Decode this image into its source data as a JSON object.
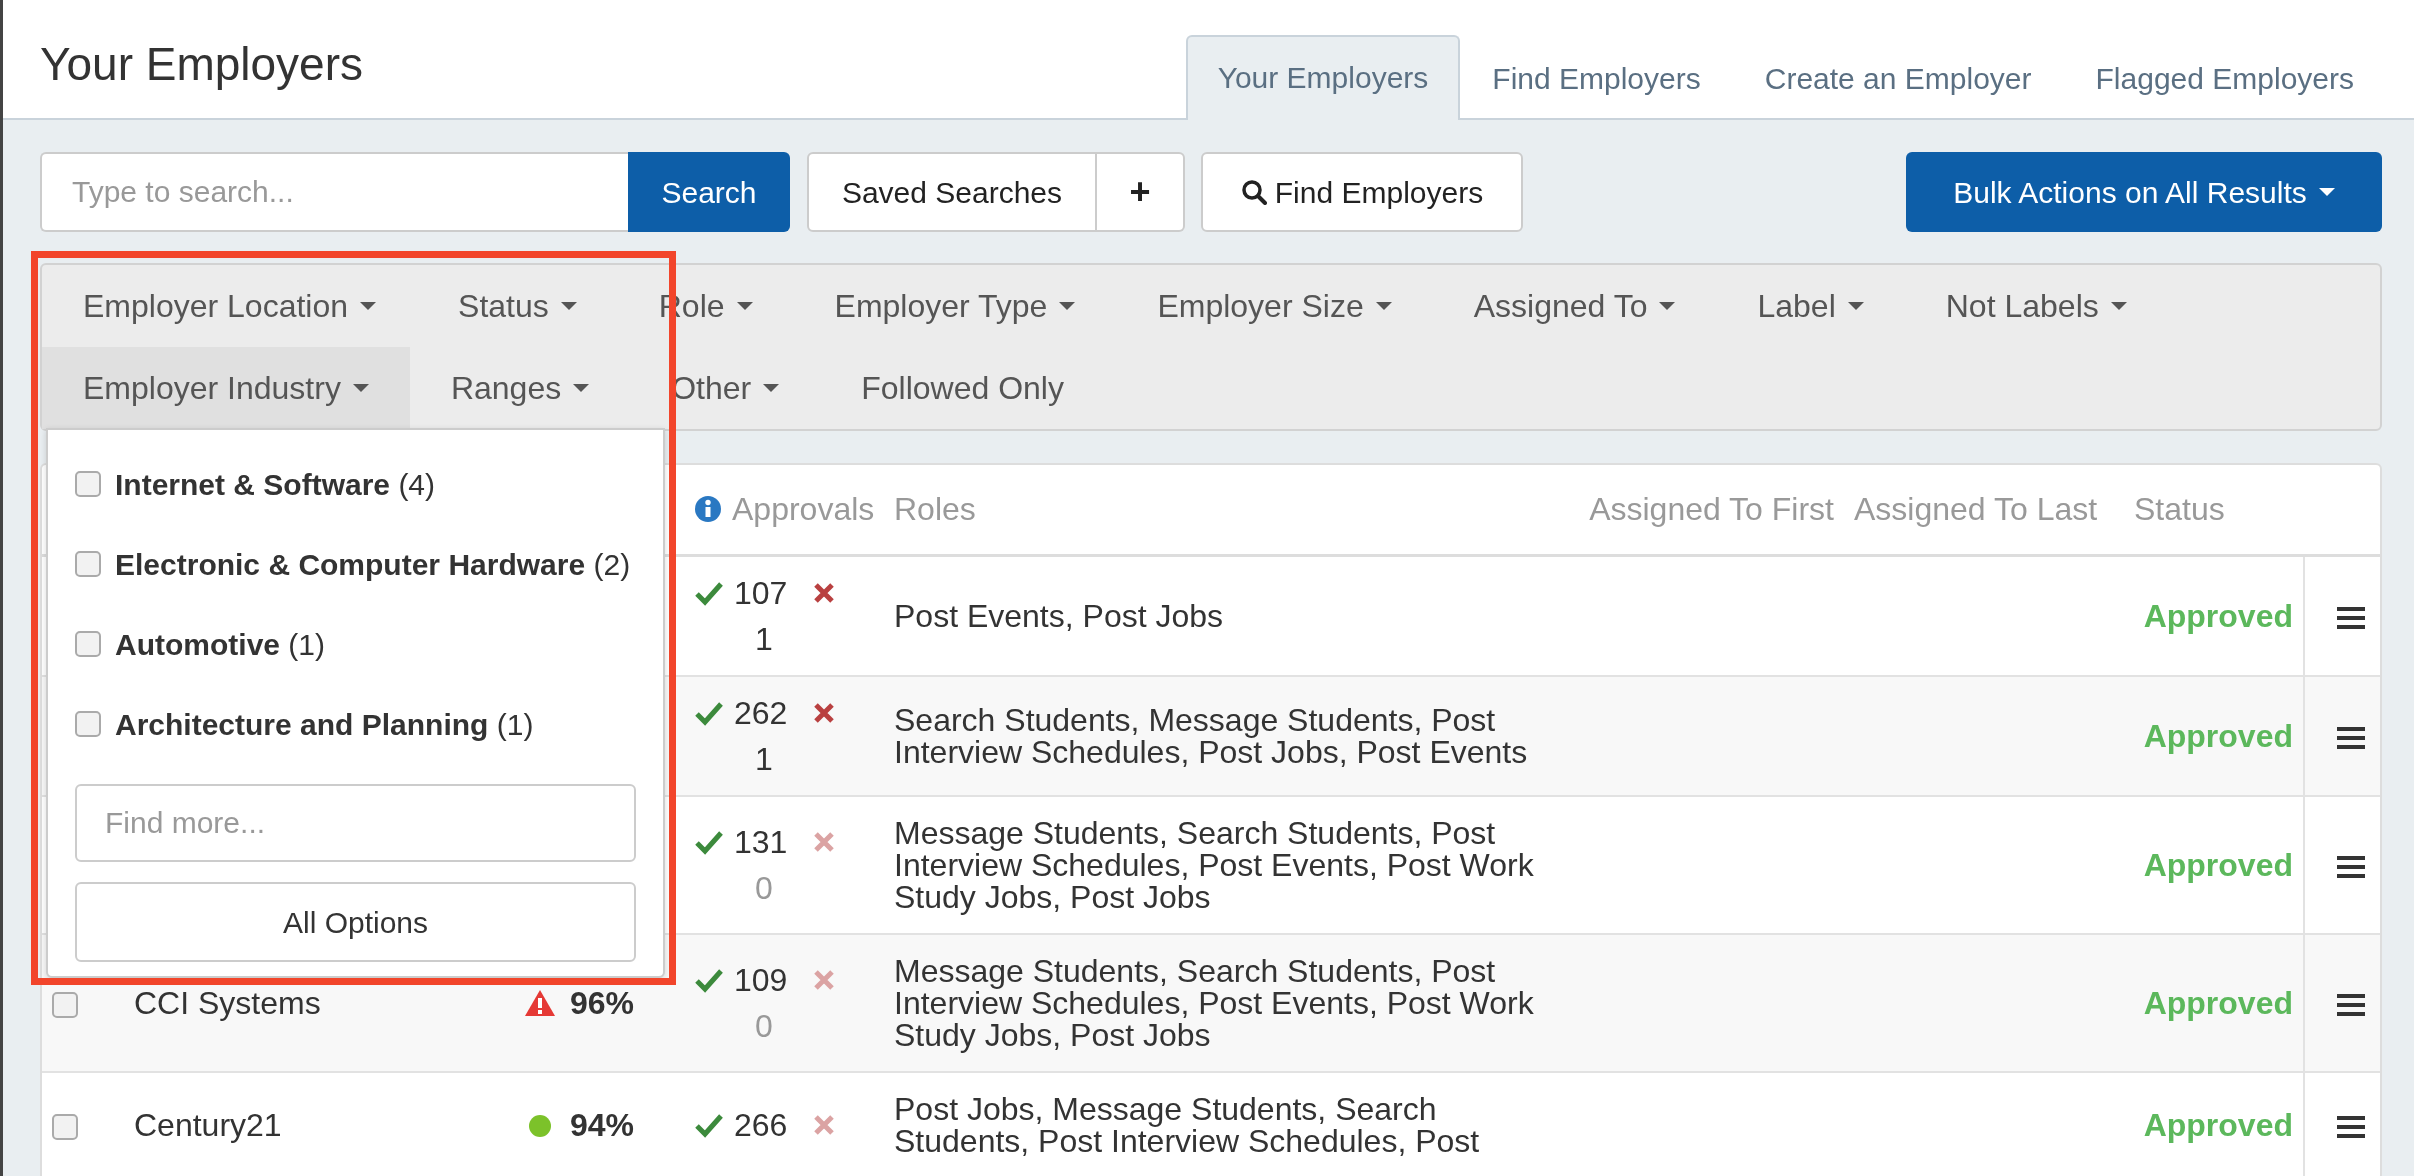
{
  "page_title": "Your Employers",
  "tabs": [
    {
      "label": "Your Employers",
      "selected": true
    },
    {
      "label": "Find Employers",
      "selected": false
    },
    {
      "label": "Create an Employer",
      "selected": false
    },
    {
      "label": "Flagged Employers",
      "selected": false
    }
  ],
  "search": {
    "placeholder": "Type to search...",
    "button": "Search"
  },
  "saved_searches": {
    "label": "Saved Searches",
    "add": "+"
  },
  "find_button": "Find Employers",
  "bulk_button": "Bulk Actions on All Results",
  "filters": [
    [
      {
        "label": "Employer Location",
        "kind": "dropdown",
        "selected": false
      },
      {
        "label": "Status",
        "kind": "dropdown",
        "selected": false
      },
      {
        "label": "Role",
        "kind": "dropdown",
        "selected": false
      },
      {
        "label": "Employer Type",
        "kind": "dropdown",
        "selected": false
      },
      {
        "label": "Employer Size",
        "kind": "dropdown",
        "selected": false
      },
      {
        "label": "Assigned To",
        "kind": "dropdown",
        "selected": false
      },
      {
        "label": "Label",
        "kind": "dropdown",
        "selected": false
      },
      {
        "label": "Not Labels",
        "kind": "dropdown",
        "selected": false
      }
    ],
    [
      {
        "label": "Employer Industry",
        "kind": "dropdown",
        "selected": true
      },
      {
        "label": "Ranges",
        "kind": "dropdown",
        "selected": false
      },
      {
        "label": "Other",
        "kind": "dropdown",
        "selected": false
      },
      {
        "label": "Followed Only",
        "kind": "toggle",
        "selected": false
      }
    ]
  ],
  "industry_menu": {
    "options": [
      {
        "label": "**Internet & Software** (4)",
        "checked": false
      },
      {
        "label": "**Electronic & Computer Hardware** (2)",
        "checked": false
      },
      {
        "label": "**Automotive** (1)",
        "checked": false
      },
      {
        "label": "**Architecture and Planning** (1)",
        "checked": false
      }
    ],
    "find_placeholder": "Find more...",
    "all_options": "All Options"
  },
  "table": {
    "columns": [
      "Approvals",
      "Roles",
      "Assigned To First",
      "Assigned To Last",
      "Status"
    ],
    "rows": [
      {
        "approved": "107",
        "rejected": "1",
        "has_rejections": true,
        "roles": "Post Events, Post Jobs",
        "status": "Approved"
      },
      {
        "approved": "262",
        "rejected": "1",
        "has_rejections": true,
        "roles": "Search Students, Message Students, Post Interview Schedules, Post Jobs, Post Events",
        "status": "Approved"
      },
      {
        "approved": "131",
        "rejected": "0",
        "has_rejections": false,
        "roles": "Message Students, Search Students, Post Interview Schedules, Post Events, Post Work Study Jobs, Post Jobs",
        "status": "Approved"
      },
      {
        "checked": false,
        "name": "CCI Systems",
        "indicator": {
          "kind": "warning"
        },
        "score": "96%",
        "approved": "109",
        "rejected": "0",
        "has_rejections": false,
        "roles": "Message Students, Search Students, Post Interview Schedules, Post Events, Post Work Study Jobs, Post Jobs",
        "status": "Approved"
      },
      {
        "checked": false,
        "name": "Century21",
        "indicator": {
          "kind": "ok"
        },
        "score": "94%",
        "approved": "266",
        "has_rejections": false,
        "roles": "Post Jobs, Message Students, Search Students, Post Interview Schedules, Post",
        "status": "Approved"
      }
    ]
  }
}
